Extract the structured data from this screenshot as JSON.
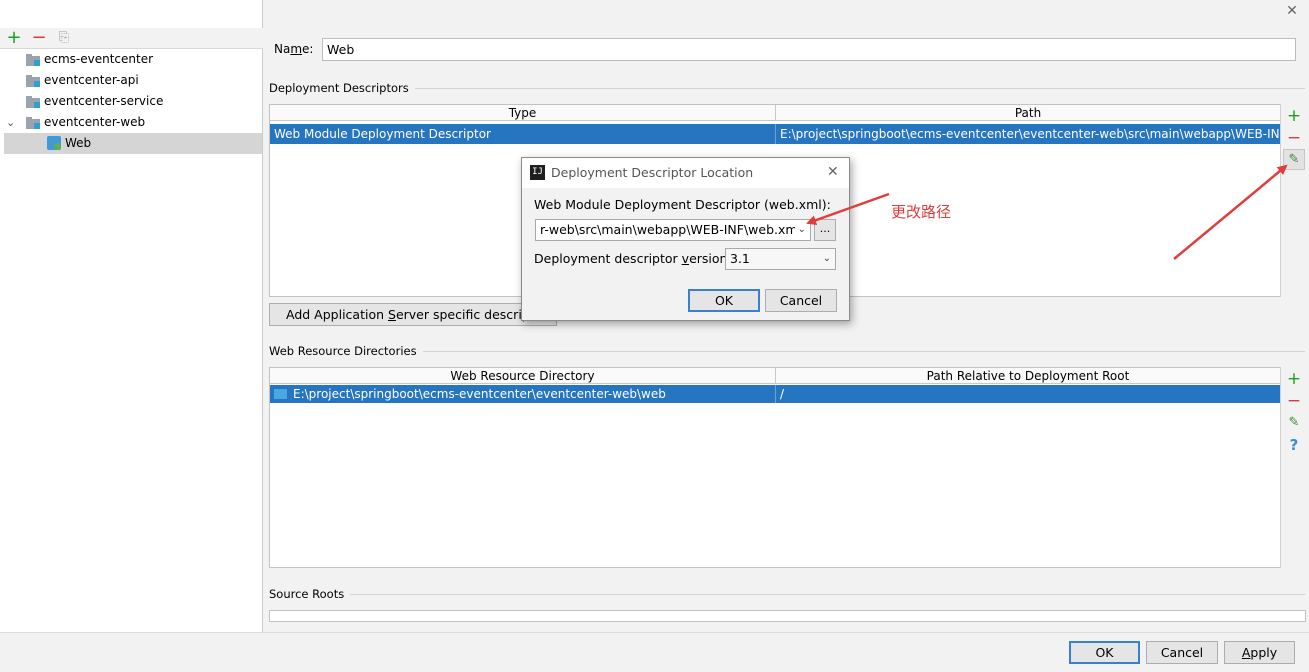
{
  "window": {
    "close_glyph": "✕"
  },
  "left_panel": {
    "toolbar": {
      "add_icon": "plus-icon",
      "remove_icon": "minus-icon",
      "copy_icon": "copy-icon"
    },
    "tree": [
      {
        "label": "ecms-eventcenter"
      },
      {
        "label": "eventcenter-api"
      },
      {
        "label": "eventcenter-service"
      },
      {
        "label": "eventcenter-web",
        "expanded": true
      },
      {
        "label": "Web",
        "selected": true
      }
    ]
  },
  "name_field": {
    "label_prefix": "Na",
    "label_mnemonic": "m",
    "label_suffix": "e:",
    "value": "Web"
  },
  "deployment_descriptors": {
    "title": "Deployment Descriptors",
    "columns": [
      "Type",
      "Path"
    ],
    "rows": [
      {
        "type": "Web Module Deployment Descriptor",
        "path": "E:\\project\\springboot\\ecms-eventcenter\\eventcenter-web\\src\\main\\webapp\\WEB-INF\\"
      }
    ],
    "add_server_button": {
      "prefix": "Add Application ",
      "mnemonic": "S",
      "suffix": "erver specific descriptor..."
    }
  },
  "web_resource_directories": {
    "title": "Web Resource Directories",
    "columns": [
      "Web Resource Directory",
      "Path Relative to Deployment Root"
    ],
    "rows": [
      {
        "directory": "E:\\project\\springboot\\ecms-eventcenter\\eventcenter-web\\web",
        "relative_path": "/"
      }
    ],
    "help_glyph": "?"
  },
  "source_roots": {
    "title": "Source Roots"
  },
  "dialog": {
    "title": "Deployment Descriptor Location",
    "app_icon_text": "IJ",
    "close_glyph": "✕",
    "location_label": "Web Module Deployment Descriptor (web.xml):",
    "location_value": "r-web\\src\\main\\webapp\\WEB-INF\\web.xml",
    "browse_label": "...",
    "version_label_prefix": "Deployment descriptor ",
    "version_label_mnemonic": "v",
    "version_label_suffix": "ersion",
    "version_value": "3.1",
    "ok_label": "OK",
    "cancel_label": "Cancel"
  },
  "annotation": {
    "text": "更改路径",
    "color": "#e23c3c"
  },
  "footer": {
    "ok_label": "OK",
    "cancel_label": "Cancel",
    "apply_prefix": "",
    "apply_mnemonic": "A",
    "apply_suffix": "pply"
  },
  "colors": {
    "selection": "#2675c0",
    "add": "#1aa31a",
    "remove": "#d23c3c",
    "default_button_border": "#3b7fd2"
  }
}
